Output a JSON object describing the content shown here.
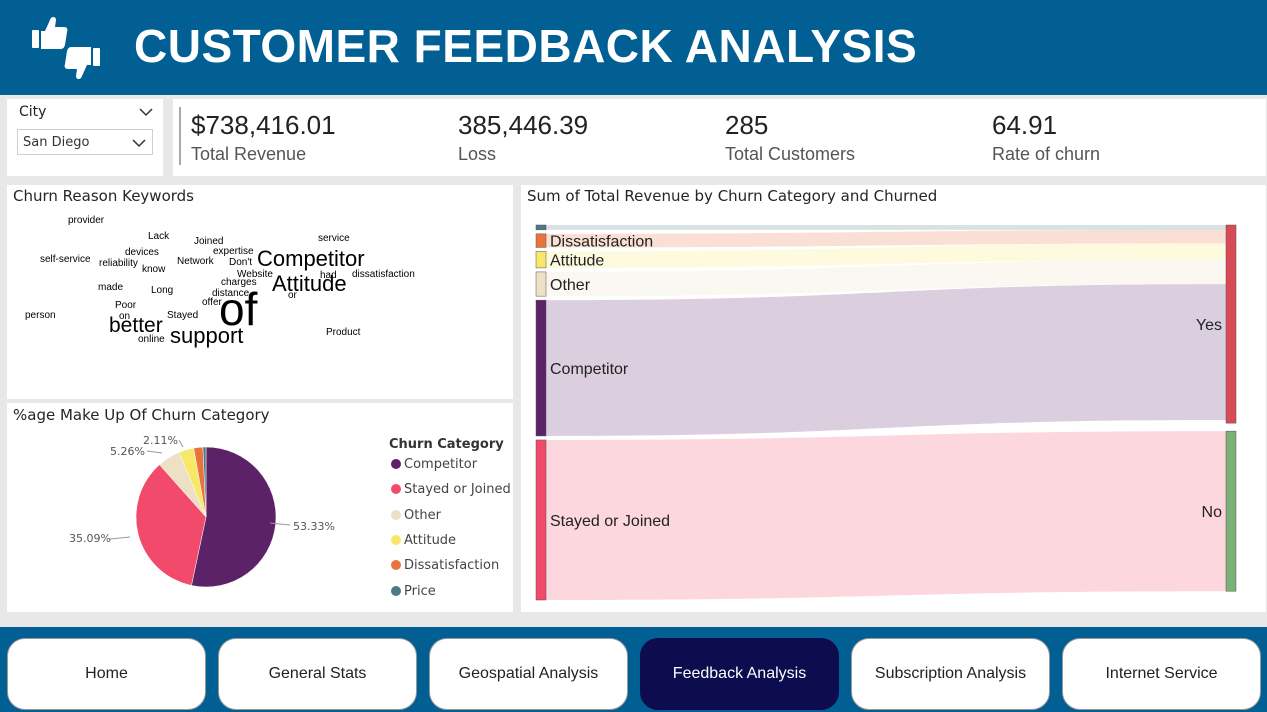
{
  "header": {
    "title": "CUSTOMER FEEDBACK ANALYSIS"
  },
  "slicer": {
    "label": "City",
    "value": "San Diego"
  },
  "kpis": [
    {
      "value": "$738,416.01",
      "label": "Total Revenue"
    },
    {
      "value": "385,446.39",
      "label": "Loss"
    },
    {
      "value": "285",
      "label": "Total Customers"
    },
    {
      "value": "64.91",
      "label": "Rate of churn"
    }
  ],
  "wordcloud": {
    "title": "Churn Reason Keywords",
    "words": [
      {
        "text": "provider",
        "color": "#2c8fe0"
      },
      {
        "text": "Lack",
        "color": "#6a55b5"
      },
      {
        "text": "Joined",
        "color": "#3ab0d8"
      },
      {
        "text": "service",
        "color": "#2c8fe0"
      },
      {
        "text": "devices",
        "color": "#d05030"
      },
      {
        "text": "expertise",
        "color": "#2a8a5a"
      },
      {
        "text": "self-service",
        "color": "#7a3f9d"
      },
      {
        "text": "reliability",
        "color": "#c84a80"
      },
      {
        "text": "Network",
        "color": "#d04040"
      },
      {
        "text": "Don't",
        "color": "#d04060"
      },
      {
        "text": "Competitor",
        "color": "#e87830"
      },
      {
        "text": "know",
        "color": "#c04090"
      },
      {
        "text": "Website",
        "color": "#9a60c0"
      },
      {
        "text": "had",
        "color": "#d05030"
      },
      {
        "text": "dissatisfaction",
        "color": "#2a9a50"
      },
      {
        "text": "made",
        "color": "#6a3a9a"
      },
      {
        "text": "Long",
        "color": "#d8a020"
      },
      {
        "text": "charges",
        "color": "#d8a020"
      },
      {
        "text": "Attitude",
        "color": "#2c8fe0"
      },
      {
        "text": "distance",
        "color": "#d8a020"
      },
      {
        "text": "or",
        "color": "#3ab0d8"
      },
      {
        "text": "Poor",
        "color": "#2a6aa0"
      },
      {
        "text": "offer",
        "color": "#9a2a2a"
      },
      {
        "text": "of",
        "color": "#2c8fe0"
      },
      {
        "text": "person",
        "color": "#1a3a7a"
      },
      {
        "text": "on",
        "color": "#2c8fe0"
      },
      {
        "text": "Stayed",
        "color": "#3ab0d8"
      },
      {
        "text": "better",
        "color": "#e87830"
      },
      {
        "text": "Product",
        "color": "#2a9a50"
      },
      {
        "text": "online",
        "color": "#2a8a8a"
      },
      {
        "text": "support",
        "color": "#2a3a9a"
      }
    ]
  },
  "pie": {
    "title": "%age Make Up Of Churn Category",
    "legend_title": "Churn Category",
    "slice_labels": [
      "53.33%",
      "35.09%",
      "5.26%",
      "2.11%"
    ]
  },
  "sankey": {
    "title": "Sum of Total Revenue by Churn Category and Churned"
  },
  "chart_data": [
    {
      "type": "pie",
      "title": "%age Make Up Of Churn Category",
      "legend_title": "Churn Category",
      "categories": [
        "Competitor",
        "Stayed or Joined",
        "Other",
        "Attitude",
        "Dissatisfaction",
        "Price"
      ],
      "values": [
        53.33,
        35.09,
        5.26,
        3.5,
        2.11,
        0.7
      ],
      "colors": [
        "#5c2267",
        "#f24a6a",
        "#ede0c4",
        "#f7e86a",
        "#e8743b",
        "#4d7a82"
      ],
      "legend_position": "right"
    },
    {
      "type": "sankey",
      "title": "Sum of Total Revenue by Churn Category and Churned",
      "source_nodes": [
        {
          "name": "Price",
          "value": 5,
          "color": "#4d7a82"
        },
        {
          "name": "Dissatisfaction",
          "value": 14,
          "color": "#e8743b"
        },
        {
          "name": "Attitude",
          "value": 17,
          "color": "#f7e86a"
        },
        {
          "name": "Other",
          "value": 25,
          "color": "#ede0c4"
        },
        {
          "name": "Competitor",
          "value": 140,
          "color": "#5c2267"
        },
        {
          "name": "Stayed or Joined",
          "value": 165,
          "color": "#f24a6a"
        }
      ],
      "target_nodes": [
        {
          "name": "Yes",
          "color": "#d94a57"
        },
        {
          "name": "No",
          "color": "#7bb077"
        }
      ],
      "links": [
        {
          "source": "Price",
          "target": "Yes"
        },
        {
          "source": "Dissatisfaction",
          "target": "Yes"
        },
        {
          "source": "Attitude",
          "target": "Yes"
        },
        {
          "source": "Other",
          "target": "Yes"
        },
        {
          "source": "Competitor",
          "target": "Yes"
        },
        {
          "source": "Stayed or Joined",
          "target": "No"
        }
      ]
    }
  ],
  "nav": {
    "items": [
      {
        "label": "Home",
        "active": false
      },
      {
        "label": "General Stats",
        "active": false
      },
      {
        "label": "Geospatial Analysis",
        "active": false
      },
      {
        "label": "Feedback Analysis",
        "active": true
      },
      {
        "label": "Subscription Analysis",
        "active": false
      },
      {
        "label": "Internet Service",
        "active": false
      }
    ]
  }
}
